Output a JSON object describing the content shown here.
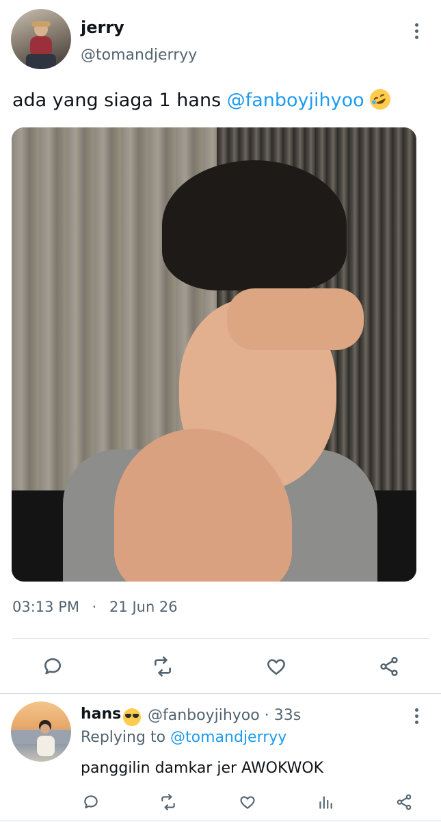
{
  "tweet": {
    "display_name": "jerry",
    "handle": "@tomandjerryy",
    "text": "ada yang siaga 1 hans ",
    "mention": "@fanboyjihyoo",
    "emoji": "rolling-on-floor-laughing",
    "time": "03:13 PM",
    "separator": "·",
    "date": "21 Jun 26",
    "actions": [
      "reply-icon",
      "retweet-icon",
      "like-icon",
      "share-icon"
    ]
  },
  "reply": {
    "display_name": "hans",
    "emoji": "smiling-face-with-sunglasses",
    "handle_time": "@fanboyjihyoo · 33s",
    "replying_prefix": "Replying to ",
    "replying_to": "@tomandjerryy",
    "text": "panggilin damkar jer AWOKWOK",
    "actions": [
      "reply-icon",
      "retweet-icon",
      "like-icon",
      "analytics-icon",
      "share-icon"
    ]
  },
  "colors": {
    "accent": "#1d9bf0",
    "secondary_text": "#536471",
    "primary_text": "#0f1419",
    "divider": "#cfd9de"
  }
}
